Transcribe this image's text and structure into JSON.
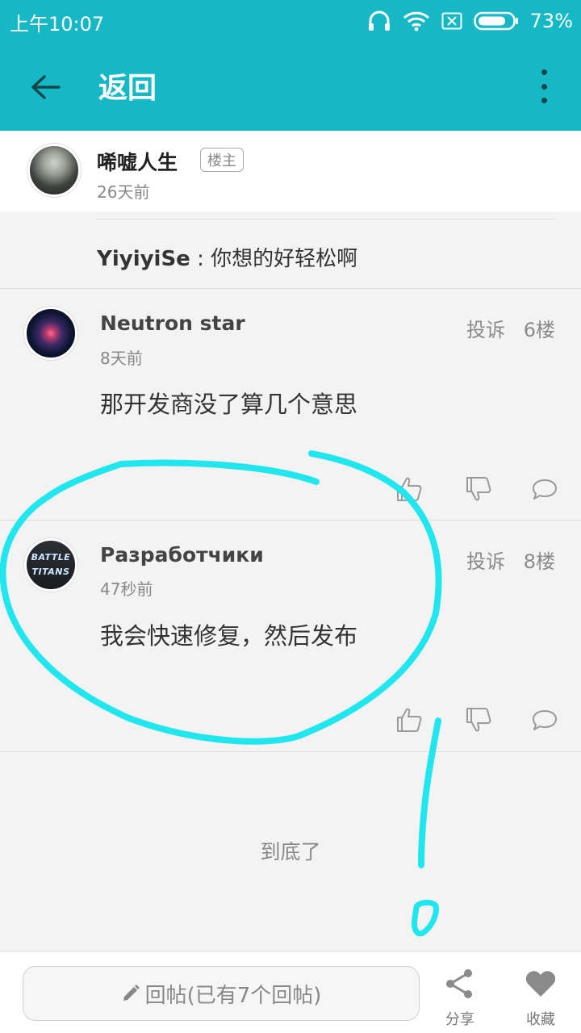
{
  "status_bar": {
    "time": "上午10:07",
    "battery_percent": "73%",
    "icons": [
      "headphones-icon",
      "wifi-icon",
      "no-sim-icon",
      "battery-icon"
    ]
  },
  "app_bar": {
    "back_icon": "arrow-left-icon",
    "title": "返回",
    "more_icon": "more-vertical-icon"
  },
  "original_post": {
    "author": "唏嘘人生",
    "badge": "楼主",
    "time": "26天前"
  },
  "quote": {
    "author": "YiyiyiSe",
    "separator": " : ",
    "text": "你想的好轻松啊"
  },
  "comments": [
    {
      "author": "Neutron star",
      "time": "8天前",
      "text": "那开发商没了算几个意思",
      "report_label": "投诉",
      "floor": "6楼"
    },
    {
      "author": "Разработчики",
      "time": "47秒前",
      "text": "我会快速修复，然后发布",
      "report_label": "投诉",
      "floor": "8楼",
      "avatar_text": [
        "BATTLE",
        "TITANS"
      ]
    }
  ],
  "end_text": "到底了",
  "bottom_bar": {
    "reply_placeholder": "回帖(已有7个回帖)",
    "share_label": "分享",
    "favorite_label": "收藏"
  },
  "colors": {
    "accent": "#16b8c6",
    "annotation": "#22e6ee",
    "background": "#f3f3f3"
  }
}
